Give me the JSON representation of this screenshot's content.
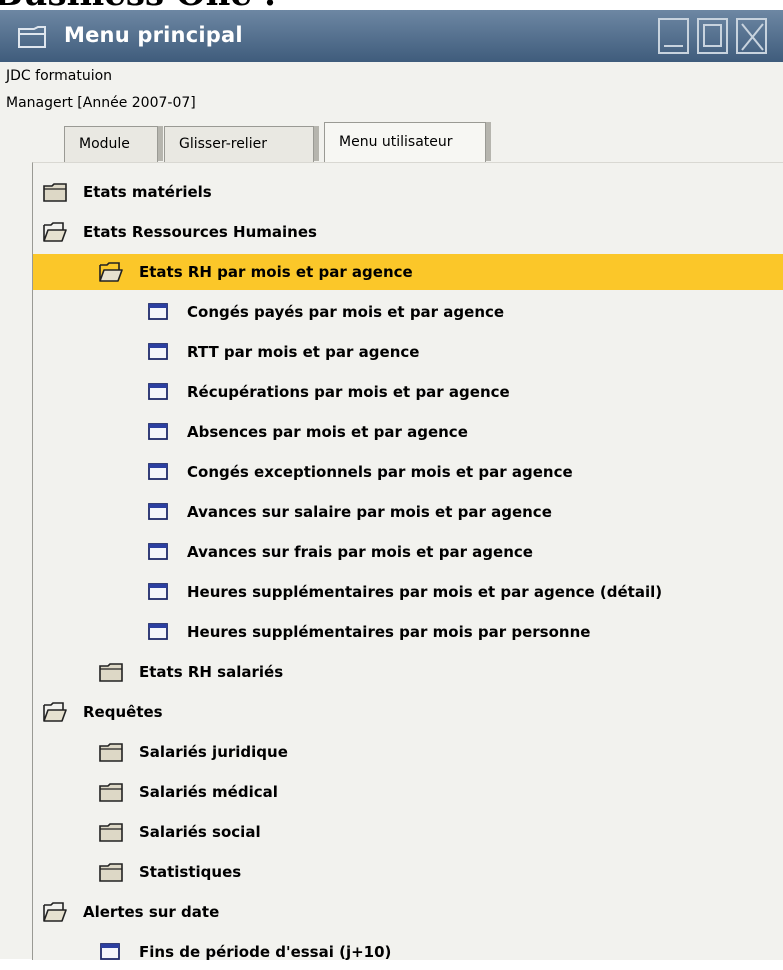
{
  "heading": {
    "text": "Business One :"
  },
  "window": {
    "title": "Menu principal",
    "company": "JDC formatuion",
    "user_line": "Managert  [Année 2007-07]"
  },
  "tabs": [
    {
      "label": "Module",
      "active": false
    },
    {
      "label": "Glisser-relier",
      "active": false
    },
    {
      "label": "Menu utilisateur",
      "active": true
    }
  ],
  "tree": [
    {
      "label": "Etats matériels",
      "icon": "folder-closed-icon",
      "level": 0,
      "selected": false
    },
    {
      "label": "Etats Ressources Humaines",
      "icon": "folder-open-icon",
      "level": 0,
      "selected": false
    },
    {
      "label": "Etats RH par mois et par agence",
      "icon": "folder-open-icon",
      "level": 1,
      "selected": true
    },
    {
      "label": "Congés payés par mois et par agence",
      "icon": "report-window-icon",
      "level": 2,
      "selected": false
    },
    {
      "label": "RTT par mois et par agence",
      "icon": "report-window-icon",
      "level": 2,
      "selected": false
    },
    {
      "label": "Récupérations par mois et par agence",
      "icon": "report-window-icon",
      "level": 2,
      "selected": false
    },
    {
      "label": "Absences par mois et par agence",
      "icon": "report-window-icon",
      "level": 2,
      "selected": false
    },
    {
      "label": "Congés exceptionnels par mois et par agence",
      "icon": "report-window-icon",
      "level": 2,
      "selected": false
    },
    {
      "label": "Avances sur salaire par mois et par agence",
      "icon": "report-window-icon",
      "level": 2,
      "selected": false
    },
    {
      "label": "Avances sur frais par mois et par agence",
      "icon": "report-window-icon",
      "level": 2,
      "selected": false
    },
    {
      "label": "Heures supplémentaires par mois et par agence (détail)",
      "icon": "report-window-icon",
      "level": 2,
      "selected": false
    },
    {
      "label": "Heures supplémentaires par mois par personne",
      "icon": "report-window-icon",
      "level": 2,
      "selected": false
    },
    {
      "label": "Etats RH salariés",
      "icon": "folder-closed-icon",
      "level": 1,
      "selected": false
    },
    {
      "label": "Requêtes",
      "icon": "folder-open-icon",
      "level": 0,
      "selected": false
    },
    {
      "label": "Salariés juridique",
      "icon": "folder-closed-icon",
      "level": 1,
      "selected": false
    },
    {
      "label": "Salariés médical",
      "icon": "folder-closed-icon",
      "level": 1,
      "selected": false
    },
    {
      "label": "Salariés social",
      "icon": "folder-closed-icon",
      "level": 1,
      "selected": false
    },
    {
      "label": "Statistiques",
      "icon": "folder-closed-icon",
      "level": 1,
      "selected": false
    },
    {
      "label": "Alertes sur date",
      "icon": "folder-open-icon",
      "level": 0,
      "selected": false
    },
    {
      "label": "Fins de période d'essai (j+10)",
      "icon": "report-window-icon",
      "level": 1,
      "selected": false
    }
  ],
  "colors": {
    "selection": "#fbc729",
    "titlebar": "#4f6b8a",
    "panel": "#f2f2ee"
  }
}
